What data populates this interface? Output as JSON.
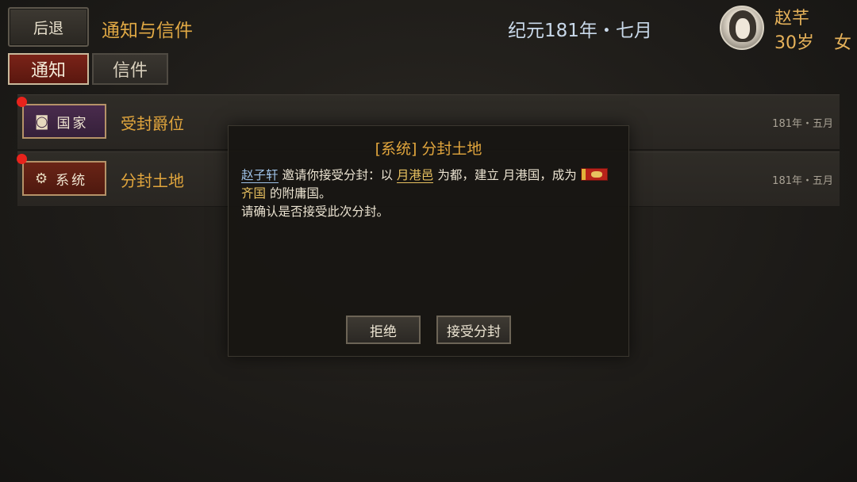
{
  "header": {
    "back_label": "后退",
    "title": "通知与信件",
    "date": "纪元181年・七月"
  },
  "character": {
    "name": "赵芊",
    "age": "30岁",
    "sex": "女"
  },
  "tabs": [
    {
      "label": "通知",
      "active": true
    },
    {
      "label": "信件",
      "active": false
    }
  ],
  "notifications": [
    {
      "tag": "国家",
      "tag_icon": "banner-icon",
      "tag_glyph": "◙",
      "title": "受封爵位",
      "date": "181年・五月",
      "unread": true
    },
    {
      "tag": "系统",
      "tag_icon": "gear-icon",
      "tag_glyph": "⚙",
      "title": "分封土地",
      "date": "181年・五月",
      "unread": true
    }
  ],
  "dialog": {
    "title": "[系统] 分封土地",
    "sender": "赵子轩",
    "text_1": " 邀请你接受分封：以 ",
    "place": "月港邑",
    "text_2": " 为都，建立 月港国，成为 ",
    "state": "齐国",
    "text_3": " 的附庸国。",
    "text_4": "请确认是否接受此次分封。",
    "reject_label": "拒绝",
    "accept_label": "接受分封"
  },
  "colors": {
    "accent_gold": "#e2a63d",
    "unread_dot": "#e8231c",
    "active_tab": "#7a2318",
    "date_blue": "#c9d9ea"
  }
}
